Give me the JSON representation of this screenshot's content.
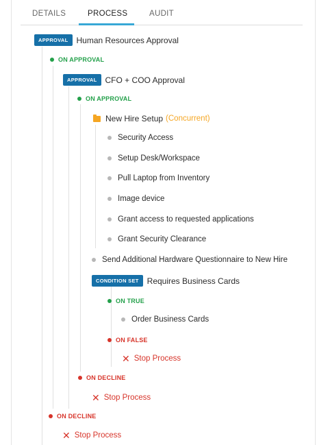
{
  "tabs": [
    "DETAILS",
    "PROCESS",
    "AUDIT"
  ],
  "badges": {
    "approval": "APPROVAL",
    "condition_set": "CONDITION SET"
  },
  "nodes": {
    "hr_approval": "Human Resources Approval",
    "on_approval": "ON APPROVAL",
    "cfo_coo_approval": "CFO + COO Approval",
    "new_hire_setup": "New Hire Setup",
    "concurrent": "(Concurrent)",
    "tasks": [
      "Security Access",
      "Setup Desk/Workspace",
      "Pull Laptop from Inventory",
      "Image device",
      "Grant access to requested applications",
      "Grant Security Clearance"
    ],
    "send_questionnaire": "Send Additional Hardware Questionnaire to New Hire",
    "requires_business_cards": "Requires Business Cards",
    "on_true": "ON TRUE",
    "order_business_cards": "Order Business Cards",
    "on_false": "ON FALSE",
    "on_decline": "ON DECLINE",
    "stop_process": "Stop Process",
    "x_symbol": "✕"
  },
  "colors": {
    "badge": "#1670a8",
    "on_branch_green": "#23a04a",
    "on_branch_red": "#d7342a",
    "folder": "#f5a623",
    "tab_underline": "#38a8d6"
  },
  "icons": [
    "folder-icon",
    "status-dot-icon",
    "stop-x-icon"
  ]
}
